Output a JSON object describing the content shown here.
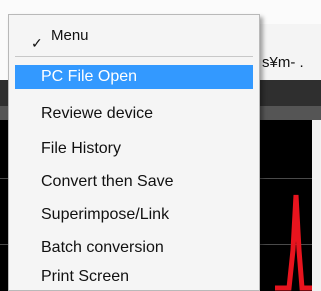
{
  "background": {
    "title_fragment": "s¥m- .",
    "trace_color": "#e8141e"
  },
  "menu": {
    "header_check": "✓",
    "header_label": "Menu",
    "selected_color": "#3399ff",
    "items": [
      {
        "label": "PC File Open",
        "selected": true
      },
      {
        "label": "Reviewe device",
        "selected": false
      },
      {
        "label": "File History",
        "selected": false
      },
      {
        "label": "Convert then Save",
        "selected": false
      },
      {
        "label": "Superimpose/Link",
        "selected": false
      },
      {
        "label": "Batch conversion",
        "selected": false
      },
      {
        "label": "Print Screen",
        "selected": false
      }
    ]
  }
}
